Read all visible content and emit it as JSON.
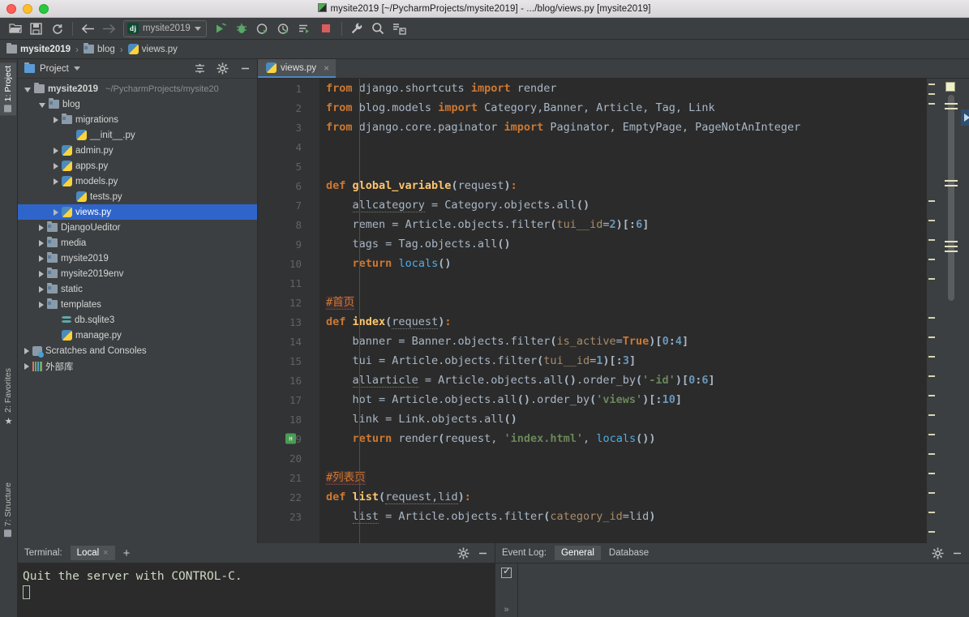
{
  "window": {
    "title": "mysite2019 [~/PycharmProjects/mysite2019] - .../blog/views.py [mysite2019]",
    "title_icon": "pycharm-icon",
    "controls": [
      "close-button",
      "minimize-button",
      "maximize-button"
    ]
  },
  "toolbar": {
    "buttons": [
      {
        "name": "open-folder-icon",
        "label": "Open"
      },
      {
        "name": "save-all-icon",
        "label": "Save All"
      },
      {
        "name": "sync-icon",
        "label": "Synchronize"
      },
      {
        "name": "back-arrow-icon",
        "label": "Back"
      },
      {
        "name": "forward-arrow-icon",
        "label": "Forward"
      }
    ],
    "run_config": {
      "badge": "dj",
      "label": "mysite2019",
      "chevron": "chevron-down-icon"
    },
    "actions": [
      {
        "name": "run-icon",
        "label": "Run"
      },
      {
        "name": "debug-icon",
        "label": "Debug"
      },
      {
        "name": "run-coverage-icon",
        "label": "Run with Coverage"
      },
      {
        "name": "profile-icon",
        "label": "Profile"
      },
      {
        "name": "run-manage-task-icon",
        "label": "Run manage.py Task"
      },
      {
        "name": "stop-icon",
        "label": "Stop"
      },
      {
        "name": "settings-wrench-icon",
        "label": "Settings"
      },
      {
        "name": "search-everywhere-icon",
        "label": "Search Everywhere"
      },
      {
        "name": "vcs-update-icon",
        "label": "Update Project"
      }
    ]
  },
  "breadcrumb": [
    {
      "label": "mysite2019",
      "icon": "folder-icon",
      "bold": true
    },
    {
      "label": "blog",
      "icon": "module-folder-icon",
      "bold": false
    },
    {
      "label": "views.py",
      "icon": "python-file-icon",
      "bold": false
    }
  ],
  "left_rail": [
    {
      "label": "1: Project",
      "icon": "project-icon",
      "active": true
    },
    {
      "label": "2: Favorites",
      "icon": "star-icon",
      "active": false
    },
    {
      "label": "7: Structure",
      "icon": "structure-icon",
      "active": false
    }
  ],
  "project_panel": {
    "title": "Project",
    "title_chevron": "chevron-down-icon",
    "header_icons": [
      "collapse-all-icon",
      "gear-icon",
      "hide-icon"
    ],
    "tree": [
      {
        "depth": 0,
        "label": "mysite2019",
        "sub": "~/PycharmProjects/mysite20",
        "icon": "folder-icon",
        "arrow": "open",
        "bold": true,
        "selected": false
      },
      {
        "depth": 1,
        "label": "blog",
        "sub": "",
        "icon": "module-folder-icon",
        "arrow": "open",
        "bold": false,
        "selected": false
      },
      {
        "depth": 2,
        "label": "migrations",
        "sub": "",
        "icon": "module-folder-icon",
        "arrow": "closed",
        "bold": false,
        "selected": false
      },
      {
        "depth": 3,
        "label": "__init__.py",
        "sub": "",
        "icon": "python-file-icon",
        "arrow": "none",
        "bold": false,
        "selected": false
      },
      {
        "depth": 2,
        "label": "admin.py",
        "sub": "",
        "icon": "python-file-icon",
        "arrow": "closed",
        "bold": false,
        "selected": false
      },
      {
        "depth": 2,
        "label": "apps.py",
        "sub": "",
        "icon": "python-file-icon",
        "arrow": "closed",
        "bold": false,
        "selected": false
      },
      {
        "depth": 2,
        "label": "models.py",
        "sub": "",
        "icon": "python-file-icon",
        "arrow": "closed",
        "bold": false,
        "selected": false
      },
      {
        "depth": 3,
        "label": "tests.py",
        "sub": "",
        "icon": "python-file-icon",
        "arrow": "none",
        "bold": false,
        "selected": false
      },
      {
        "depth": 2,
        "label": "views.py",
        "sub": "",
        "icon": "python-file-icon",
        "arrow": "closed",
        "bold": false,
        "selected": true
      },
      {
        "depth": 1,
        "label": "DjangoUeditor",
        "sub": "",
        "icon": "module-folder-icon",
        "arrow": "closed",
        "bold": false,
        "selected": false
      },
      {
        "depth": 1,
        "label": "media",
        "sub": "",
        "icon": "module-folder-icon",
        "arrow": "closed",
        "bold": false,
        "selected": false
      },
      {
        "depth": 1,
        "label": "mysite2019",
        "sub": "",
        "icon": "module-folder-icon",
        "arrow": "closed",
        "bold": false,
        "selected": false
      },
      {
        "depth": 1,
        "label": "mysite2019env",
        "sub": "",
        "icon": "module-folder-icon",
        "arrow": "closed",
        "bold": false,
        "selected": false
      },
      {
        "depth": 1,
        "label": "static",
        "sub": "",
        "icon": "module-folder-icon",
        "arrow": "closed",
        "bold": false,
        "selected": false
      },
      {
        "depth": 1,
        "label": "templates",
        "sub": "",
        "icon": "module-folder-icon",
        "arrow": "closed",
        "bold": false,
        "selected": false
      },
      {
        "depth": 2,
        "label": "db.sqlite3",
        "sub": "",
        "icon": "database-icon",
        "arrow": "none",
        "bold": false,
        "selected": false
      },
      {
        "depth": 2,
        "label": "manage.py",
        "sub": "",
        "icon": "python-file-icon",
        "arrow": "none",
        "bold": false,
        "selected": false
      },
      {
        "depth": 0,
        "label": "Scratches and Consoles",
        "sub": "",
        "icon": "scratches-icon",
        "arrow": "closed",
        "bold": false,
        "selected": false
      },
      {
        "depth": 0,
        "label": "外部库",
        "sub": "",
        "icon": "external-libraries-icon",
        "arrow": "closed",
        "bold": false,
        "selected": false
      }
    ]
  },
  "editor": {
    "tab": {
      "label": "views.py",
      "icon": "python-file-icon",
      "close": "×"
    },
    "first_line": 1,
    "lines": [
      {
        "n": 1,
        "fold": "tri",
        "run": false,
        "tokens": [
          {
            "t": "from",
            "c": "kw"
          },
          {
            "t": " django.shortcuts ",
            "c": "var"
          },
          {
            "t": "import",
            "c": "kw"
          },
          {
            "t": " render",
            "c": "var"
          }
        ]
      },
      {
        "n": 2,
        "fold": "",
        "run": false,
        "tokens": [
          {
            "t": "from",
            "c": "kw"
          },
          {
            "t": " blog.models ",
            "c": "var"
          },
          {
            "t": "import",
            "c": "kw"
          },
          {
            "t": " Category",
            "c": "var"
          },
          {
            "t": ",",
            "c": "var"
          },
          {
            "t": "Banner",
            "c": "var"
          },
          {
            "t": ", Article, Tag, Link",
            "c": "var"
          }
        ]
      },
      {
        "n": 3,
        "fold": "circ",
        "run": false,
        "tokens": [
          {
            "t": "from",
            "c": "kw"
          },
          {
            "t": " django.core.paginator ",
            "c": "var"
          },
          {
            "t": "import",
            "c": "kw"
          },
          {
            "t": " Paginator",
            "c": "var"
          },
          {
            "t": ", EmptyPage, PageNotAnInteger",
            "c": "var"
          }
        ]
      },
      {
        "n": 4,
        "fold": "",
        "run": false,
        "tokens": []
      },
      {
        "n": 5,
        "fold": "",
        "run": false,
        "tokens": []
      },
      {
        "n": 6,
        "fold": "tri",
        "run": false,
        "tokens": [
          {
            "t": "def ",
            "c": "kw"
          },
          {
            "t": "global_variable",
            "c": "fn"
          },
          {
            "t": "(",
            "c": "brk"
          },
          {
            "t": "request",
            "c": "var"
          },
          {
            "t": ")",
            "c": "brk"
          },
          {
            "t": ":",
            "c": "kw"
          }
        ]
      },
      {
        "n": 7,
        "fold": "",
        "run": false,
        "tokens": [
          {
            "t": "    ",
            "c": "var"
          },
          {
            "t": "allcategory",
            "c": "greenvar"
          },
          {
            "t": " = Category.objects.",
            "c": "var"
          },
          {
            "t": "all",
            "c": "var"
          },
          {
            "t": "()",
            "c": "brk"
          }
        ]
      },
      {
        "n": 8,
        "fold": "",
        "run": false,
        "tokens": [
          {
            "t": "    remen = Article.objects.filter",
            "c": "var"
          },
          {
            "t": "(",
            "c": "brk"
          },
          {
            "t": "tui__id",
            "c": "kwarg"
          },
          {
            "t": "=",
            "c": "var"
          },
          {
            "t": "2",
            "c": "num"
          },
          {
            "t": ")[:",
            "c": "brk"
          },
          {
            "t": "6",
            "c": "num"
          },
          {
            "t": "]",
            "c": "brk"
          }
        ]
      },
      {
        "n": 9,
        "fold": "",
        "run": false,
        "tokens": [
          {
            "t": "    tags = Tag.objects.all",
            "c": "var"
          },
          {
            "t": "()",
            "c": "brk"
          }
        ]
      },
      {
        "n": 10,
        "fold": "circ",
        "run": false,
        "tokens": [
          {
            "t": "    ",
            "c": "var"
          },
          {
            "t": "return",
            "c": "kw"
          },
          {
            "t": " ",
            "c": "var"
          },
          {
            "t": "locals",
            "c": "teal"
          },
          {
            "t": "()",
            "c": "brk"
          }
        ]
      },
      {
        "n": 11,
        "fold": "",
        "run": false,
        "tokens": []
      },
      {
        "n": 12,
        "fold": "",
        "run": false,
        "tokens": [
          {
            "t": "#首页",
            "c": "cmt-hl"
          }
        ]
      },
      {
        "n": 13,
        "fold": "tri",
        "run": false,
        "tokens": [
          {
            "t": "def ",
            "c": "kw"
          },
          {
            "t": "index",
            "c": "fn"
          },
          {
            "t": "(",
            "c": "brk"
          },
          {
            "t": "request",
            "c": "wavy"
          },
          {
            "t": ")",
            "c": "brk"
          },
          {
            "t": ":",
            "c": "kw"
          }
        ]
      },
      {
        "n": 14,
        "fold": "",
        "run": false,
        "tokens": [
          {
            "t": "    banner = Banner.objects.filter",
            "c": "var"
          },
          {
            "t": "(",
            "c": "brk"
          },
          {
            "t": "is_active",
            "c": "kwarg"
          },
          {
            "t": "=",
            "c": "var"
          },
          {
            "t": "True",
            "c": "kw"
          },
          {
            "t": ")[",
            "c": "brk"
          },
          {
            "t": "0",
            "c": "num"
          },
          {
            "t": ":",
            "c": "brk"
          },
          {
            "t": "4",
            "c": "num"
          },
          {
            "t": "]",
            "c": "brk"
          }
        ]
      },
      {
        "n": 15,
        "fold": "",
        "run": false,
        "tokens": [
          {
            "t": "    tui = Article.objects.filter",
            "c": "var"
          },
          {
            "t": "(",
            "c": "brk"
          },
          {
            "t": "tui__id",
            "c": "kwarg"
          },
          {
            "t": "=",
            "c": "var"
          },
          {
            "t": "1",
            "c": "num"
          },
          {
            "t": ")[:",
            "c": "brk"
          },
          {
            "t": "3",
            "c": "num"
          },
          {
            "t": "]",
            "c": "brk"
          }
        ]
      },
      {
        "n": 16,
        "fold": "",
        "run": false,
        "tokens": [
          {
            "t": "    ",
            "c": "var"
          },
          {
            "t": "allarticle",
            "c": "greenvar"
          },
          {
            "t": " = Article.objects.all",
            "c": "var"
          },
          {
            "t": "()",
            "c": "brk"
          },
          {
            "t": ".order_by",
            "c": "var"
          },
          {
            "t": "(",
            "c": "brk"
          },
          {
            "t": "'-id'",
            "c": "str"
          },
          {
            "t": ")[",
            "c": "brk"
          },
          {
            "t": "0",
            "c": "num"
          },
          {
            "t": ":",
            "c": "brk"
          },
          {
            "t": "6",
            "c": "num"
          },
          {
            "t": "]",
            "c": "brk"
          }
        ]
      },
      {
        "n": 17,
        "fold": "",
        "run": false,
        "tokens": [
          {
            "t": "    hot = Article.objects.all",
            "c": "var"
          },
          {
            "t": "()",
            "c": "brk"
          },
          {
            "t": ".order_by",
            "c": "var"
          },
          {
            "t": "(",
            "c": "brk"
          },
          {
            "t": "'views'",
            "c": "str"
          },
          {
            "t": ")[:",
            "c": "brk"
          },
          {
            "t": "10",
            "c": "num"
          },
          {
            "t": "]",
            "c": "brk"
          }
        ]
      },
      {
        "n": 18,
        "fold": "",
        "run": false,
        "tokens": [
          {
            "t": "    link = Link.objects.all",
            "c": "var"
          },
          {
            "t": "()",
            "c": "brk"
          }
        ]
      },
      {
        "n": 19,
        "fold": "circ",
        "run": true,
        "tokens": [
          {
            "t": "    ",
            "c": "var"
          },
          {
            "t": "return",
            "c": "kw"
          },
          {
            "t": " render",
            "c": "var"
          },
          {
            "t": "(",
            "c": "brk"
          },
          {
            "t": "request, ",
            "c": "var"
          },
          {
            "t": "'index.html'",
            "c": "str"
          },
          {
            "t": ", ",
            "c": "var"
          },
          {
            "t": "locals",
            "c": "teal"
          },
          {
            "t": "())",
            "c": "brk"
          }
        ]
      },
      {
        "n": 20,
        "fold": "",
        "run": false,
        "tokens": []
      },
      {
        "n": 21,
        "fold": "",
        "run": false,
        "tokens": [
          {
            "t": "#列表页",
            "c": "cmt-hl"
          }
        ]
      },
      {
        "n": 22,
        "fold": "tri",
        "run": false,
        "tokens": [
          {
            "t": "def ",
            "c": "kw"
          },
          {
            "t": "list",
            "c": "fn"
          },
          {
            "t": "(",
            "c": "brk"
          },
          {
            "t": "request,lid",
            "c": "wavy"
          },
          {
            "t": ")",
            "c": "brk"
          },
          {
            "t": ":",
            "c": "kw"
          }
        ]
      },
      {
        "n": 23,
        "fold": "",
        "run": false,
        "tokens": [
          {
            "t": "    ",
            "c": "var"
          },
          {
            "t": "list",
            "c": "greenvar"
          },
          {
            "t": " = Article.objects.filter",
            "c": "var"
          },
          {
            "t": "(",
            "c": "brk"
          },
          {
            "t": "category_id",
            "c": "kwarg"
          },
          {
            "t": "=",
            "c": "var"
          },
          {
            "t": "lid",
            "c": "var"
          },
          {
            "t": ")",
            "c": "brk"
          }
        ]
      }
    ]
  },
  "terminal": {
    "title": "Terminal:",
    "tabs": [
      {
        "label": "Local",
        "close": "×",
        "active": true
      }
    ],
    "add_label": "+",
    "icons": [
      "gear-icon",
      "hide-icon"
    ],
    "output": "Quit the server with CONTROL-C."
  },
  "event_log": {
    "title": "Event Log:",
    "tabs": [
      {
        "label": "General",
        "active": true
      },
      {
        "label": "Database",
        "active": false
      }
    ],
    "icons": [
      "gear-icon",
      "hide-icon"
    ],
    "strip": {
      "checkbox": "checkbox-icon",
      "more": "»"
    }
  },
  "colors": {
    "accent_blue": "#2f65ca",
    "panel_bg": "#3c3f41",
    "editor_bg": "#2b2b2b",
    "gutter_bg": "#313335",
    "keyword": "#cc7832",
    "string": "#6a8759",
    "number": "#6897bb",
    "function": "#ffc66d",
    "tab_underline": "#4a88c7"
  }
}
